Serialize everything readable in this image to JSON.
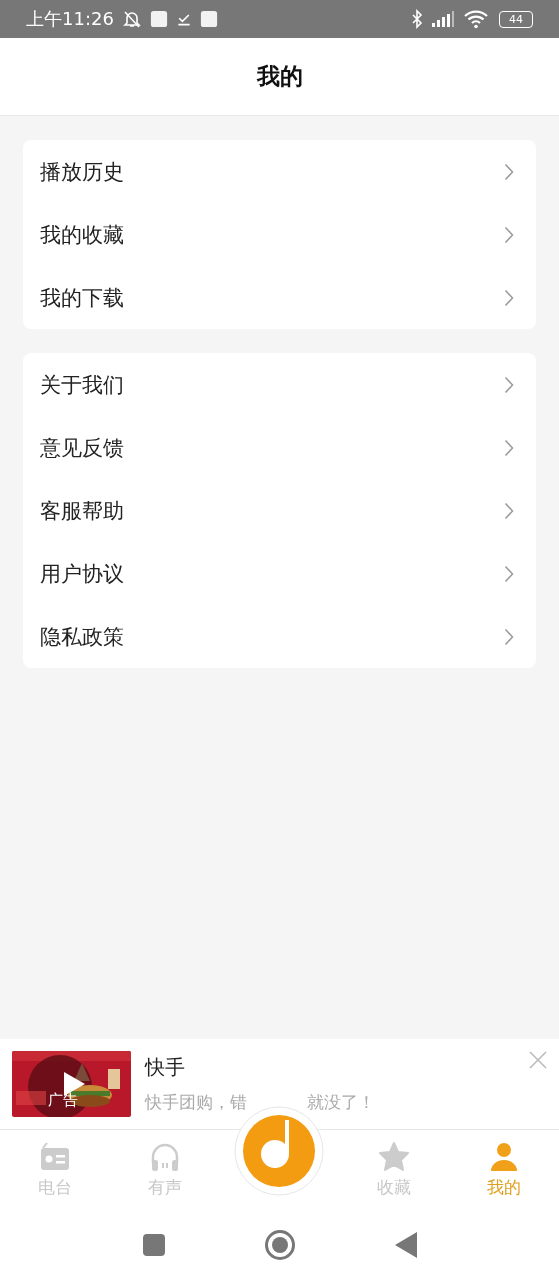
{
  "status_bar": {
    "time": "上午11:26",
    "battery": "44"
  },
  "header": {
    "title": "我的"
  },
  "menu_groups": [
    {
      "items": [
        {
          "label": "播放历史"
        },
        {
          "label": "我的收藏"
        },
        {
          "label": "我的下载"
        }
      ]
    },
    {
      "items": [
        {
          "label": "关于我们"
        },
        {
          "label": "意见反馈"
        },
        {
          "label": "客服帮助"
        },
        {
          "label": "用户协议"
        },
        {
          "label": "隐私政策"
        }
      ]
    }
  ],
  "ad": {
    "image": {
      "kind": "picture"
    },
    "badge": "广告",
    "title": "快手",
    "subtitle_parts": [
      "快手团购，错",
      "就没了！"
    ]
  },
  "tab_bar": [
    {
      "kind": "radio",
      "label": "电台",
      "selected": false
    },
    {
      "kind": "headphones",
      "label": "有声",
      "selected": false
    },
    {
      "kind": "player"
    },
    {
      "kind": "star",
      "label": "收藏",
      "selected": false
    },
    {
      "kind": "person",
      "label": "我的",
      "selected": true
    }
  ]
}
